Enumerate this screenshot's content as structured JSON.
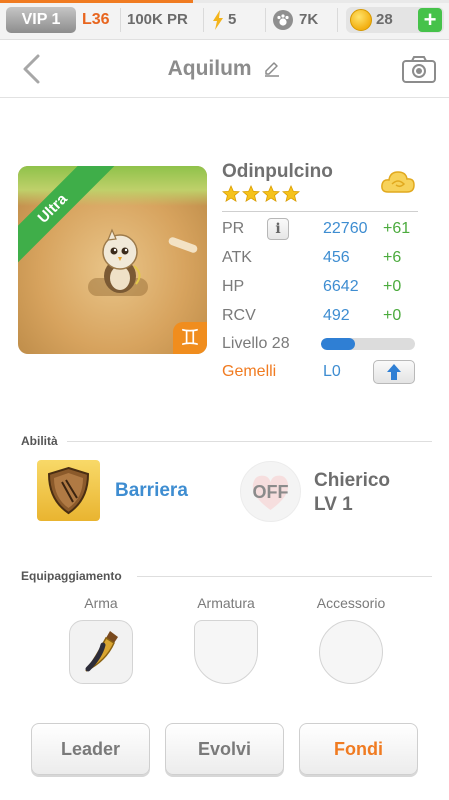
{
  "status_bar": {
    "xp_progress": 0.43,
    "vip_label": "VIP 1",
    "level": "L36",
    "power": "100K PR",
    "energy": "5",
    "paws": "7K",
    "coins": "28",
    "add_label": "+"
  },
  "header": {
    "title": "Aquilum",
    "icons": [
      "back-chevron-icon",
      "pencil-icon",
      "camera-icon"
    ]
  },
  "creature": {
    "name": "Odinpulcino",
    "rarity": "Ultra",
    "star_count": 4,
    "element_symbol": "♊",
    "stats": [
      {
        "label": "PR",
        "value": "22760",
        "bonus": "+61"
      },
      {
        "label": "ATK",
        "value": "456",
        "bonus": "+6"
      },
      {
        "label": "HP",
        "value": "6642",
        "bonus": "+0"
      },
      {
        "label": "RCV",
        "value": "492",
        "bonus": "+0"
      }
    ],
    "info_label": "i",
    "level_label": "Livello 28",
    "level_progress": 0.36,
    "sign_label": "Gemelli",
    "sign_level": "L0"
  },
  "abilities": {
    "section_title": "Abilità",
    "skill_name": "Barriera",
    "leader_status": "OFF",
    "leader_name": "Chierico",
    "leader_level": "LV 1"
  },
  "equipment": {
    "section_title": "Equipaggiamento",
    "slots": [
      "Arma",
      "Armatura",
      "Accessorio"
    ]
  },
  "actions": {
    "leader": "Leader",
    "evolve": "Evolvi",
    "merge": "Fondi"
  },
  "colors": {
    "accent_orange": "#f07b21",
    "stat_blue": "#3e8dd1",
    "bonus_green": "#4cab3e",
    "rarity_green": "#3fae49"
  }
}
